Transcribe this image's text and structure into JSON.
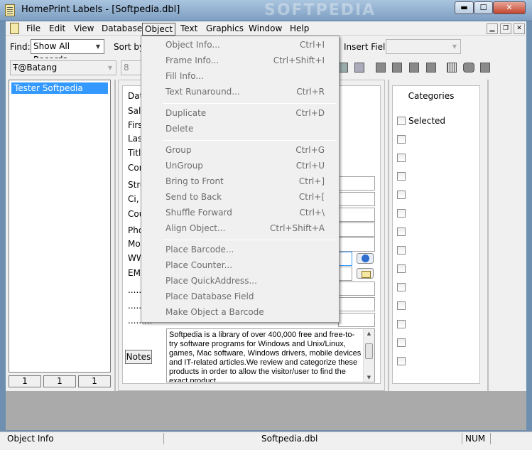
{
  "window": {
    "title": "HomePrint Labels - [Softpedia.dbl]",
    "watermark": "SOFTPEDIA",
    "minimize": "▬",
    "maximize": "☐",
    "close": "✕"
  },
  "menubar": {
    "items": [
      "File",
      "Edit",
      "View",
      "Database",
      "Object",
      "Text",
      "Graphics",
      "Window",
      "Help"
    ],
    "active": "Object",
    "mdi_min": "▁",
    "mdi_restore": "❐",
    "mdi_close": "✕"
  },
  "toolbar1": {
    "find_label": "Find:",
    "find_value": "Show All Records",
    "sortby_label": "Sort by:",
    "insert_field_label": "Insert Field:",
    "insert_field_value": ""
  },
  "toolbar2": {
    "font_icon": "Ŧ",
    "font_value": "@Batang",
    "size_value": "8"
  },
  "records": {
    "items": [
      "Tester Softpedia"
    ],
    "counters": [
      "1",
      "1",
      "1"
    ]
  },
  "form": {
    "labels": [
      "Dat",
      "Salu",
      "First",
      "Las",
      "Title",
      "Con",
      "Stre",
      "Ci, S",
      "Cou",
      "Pho",
      "Mob",
      "WW",
      "EM.",
      ".........",
      ".........",
      "........."
    ],
    "notes_button": "Notes",
    "notes_text": "Softpedia is a library of over 400,000 free and free-to-try software programs for Windows and Unix/Linux, games, Mac software, Windows drivers, mobile devices and IT-related articles.We review and categorize these products in order to allow the visitor/user to find the exact product"
  },
  "categories": {
    "title": "Categories",
    "selected_label": "Selected"
  },
  "object_menu": {
    "items": [
      {
        "label": "Object Info...",
        "shortcut": "Ctrl+I"
      },
      {
        "label": "Frame Info...",
        "shortcut": "Ctrl+Shift+I"
      },
      {
        "label": "Fill Info...",
        "shortcut": ""
      },
      {
        "label": "Text Runaround...",
        "shortcut": "Ctrl+R"
      },
      {
        "label": "Duplicate",
        "shortcut": "Ctrl+D"
      },
      {
        "label": "Delete",
        "shortcut": ""
      },
      {
        "label": "Group",
        "shortcut": "Ctrl+G"
      },
      {
        "label": "UnGroup",
        "shortcut": "Ctrl+U"
      },
      {
        "label": "Bring to Front",
        "shortcut": "Ctrl+]"
      },
      {
        "label": "Send to Back",
        "shortcut": "Ctrl+["
      },
      {
        "label": "Shuffle Forward",
        "shortcut": "Ctrl+\\"
      },
      {
        "label": "Align Object...",
        "shortcut": "Ctrl+Shift+A"
      },
      {
        "label": "Place Barcode...",
        "shortcut": ""
      },
      {
        "label": "Place Counter...",
        "shortcut": ""
      },
      {
        "label": "Place QuickAddress...",
        "shortcut": ""
      },
      {
        "label": "Place Database Field",
        "shortcut": ""
      },
      {
        "label": "Make Object a Barcode",
        "shortcut": ""
      }
    ]
  },
  "statusbar": {
    "left": "Object Info",
    "center": "Softpedia.dbl",
    "right": "NUM"
  }
}
